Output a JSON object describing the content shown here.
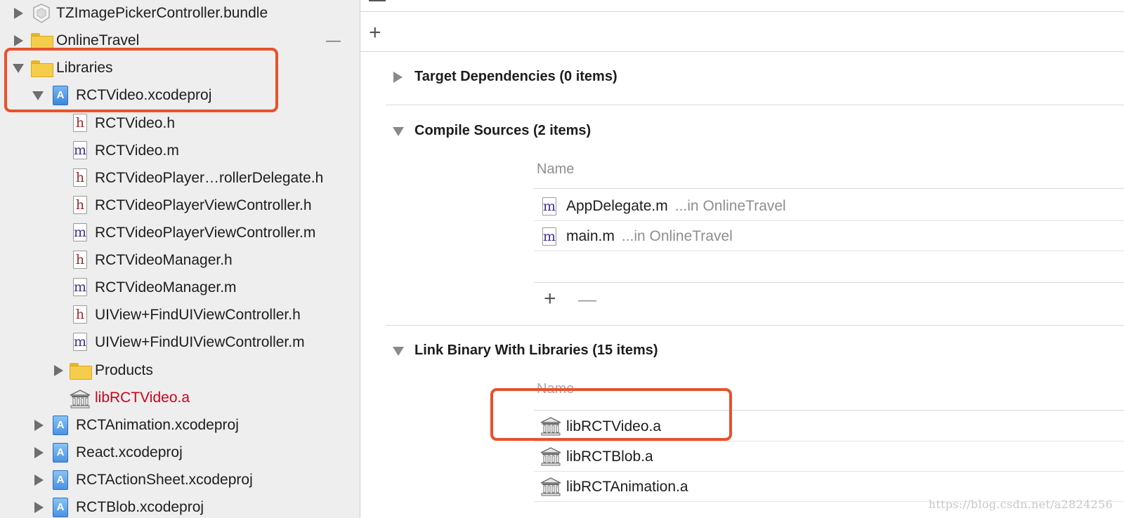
{
  "navigator": {
    "items": [
      {
        "label": "TZImagePickerController.bundle",
        "icon": "bundle-icon",
        "indent": 0,
        "disclosure": "collapsed"
      },
      {
        "label": "OnlineTravel",
        "icon": "folder-icon",
        "indent": 0,
        "disclosure": "collapsed",
        "trailing": "—"
      },
      {
        "label": "Libraries",
        "icon": "folder-icon",
        "indent": 0,
        "disclosure": "expanded"
      },
      {
        "label": "RCTVideo.xcodeproj",
        "icon": "xcodeproj-icon",
        "indent": 1,
        "disclosure": "expanded"
      },
      {
        "label": "RCTVideo.h",
        "icon": "header-file-icon",
        "glyph": "h",
        "indent": 2
      },
      {
        "label": "RCTVideo.m",
        "icon": "objc-file-icon",
        "glyph": "m",
        "indent": 2
      },
      {
        "label": "RCTVideoPlayer…rollerDelegate.h",
        "icon": "header-file-icon",
        "glyph": "h",
        "indent": 2
      },
      {
        "label": "RCTVideoPlayerViewController.h",
        "icon": "header-file-icon",
        "glyph": "h",
        "indent": 2
      },
      {
        "label": "RCTVideoPlayerViewController.m",
        "icon": "objc-file-icon",
        "glyph": "m",
        "indent": 2
      },
      {
        "label": "RCTVideoManager.h",
        "icon": "header-file-icon",
        "glyph": "h",
        "indent": 2
      },
      {
        "label": "RCTVideoManager.m",
        "icon": "objc-file-icon",
        "glyph": "m",
        "indent": 2
      },
      {
        "label": "UIView+FindUIViewController.h",
        "icon": "header-file-icon",
        "glyph": "h",
        "indent": 2
      },
      {
        "label": "UIView+FindUIViewController.m",
        "icon": "objc-file-icon",
        "glyph": "m",
        "indent": 2
      },
      {
        "label": "Products",
        "icon": "folder-icon",
        "indent": 2,
        "disclosure": "collapsed"
      },
      {
        "label": "libRCTVideo.a",
        "icon": "library-icon",
        "indent": 2,
        "color": "#d0021b"
      },
      {
        "label": "RCTAnimation.xcodeproj",
        "icon": "xcodeproj-icon",
        "indent": 1,
        "disclosure": "collapsed"
      },
      {
        "label": "React.xcodeproj",
        "icon": "xcodeproj-icon",
        "indent": 1,
        "disclosure": "collapsed"
      },
      {
        "label": "RCTActionSheet.xcodeproj",
        "icon": "xcodeproj-icon",
        "indent": 1,
        "disclosure": "collapsed"
      },
      {
        "label": "RCTBlob.xcodeproj",
        "icon": "xcodeproj-icon",
        "indent": 1,
        "disclosure": "collapsed"
      }
    ]
  },
  "build_phases": {
    "add_symbol": "+",
    "remove_symbol": "—",
    "target_dependencies": {
      "label": "Target Dependencies",
      "count": "(0 items)"
    },
    "compile_sources": {
      "label": "Compile Sources",
      "count": "(2 items)",
      "column_name": "Name",
      "rows": [
        {
          "name": "AppDelegate.m",
          "location": "...in OnlineTravel",
          "glyph": "m"
        },
        {
          "name": "main.m",
          "location": "...in OnlineTravel",
          "glyph": "m"
        }
      ]
    },
    "link_binary": {
      "label": "Link Binary With Libraries",
      "count": "(15 items)",
      "column_name": "Name",
      "rows": [
        {
          "name": "libRCTVideo.a"
        },
        {
          "name": "libRCTBlob.a"
        },
        {
          "name": "libRCTAnimation.a"
        }
      ]
    }
  },
  "watermark": "https://blog.csdn.net/a2824256",
  "colors": {
    "highlight": "#e8512b",
    "missing_file": "#d0021b",
    "sidebar_bg": "#eeeeee"
  }
}
